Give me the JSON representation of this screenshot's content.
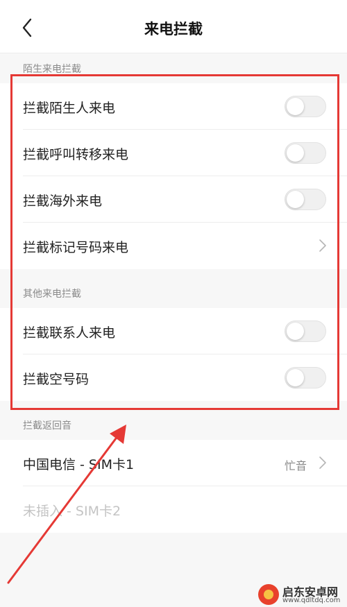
{
  "header": {
    "title": "来电拦截"
  },
  "stranger_section": {
    "label": "陌生来电拦截",
    "rows": [
      {
        "label": "拦截陌生人来电",
        "on": false
      },
      {
        "label": "拦截呼叫转移来电",
        "on": false
      },
      {
        "label": "拦截海外来电",
        "on": false
      },
      {
        "label": "拦截标记号码来电"
      }
    ]
  },
  "other_section": {
    "label": "其他来电拦截",
    "rows": [
      {
        "label": "拦截联系人来电",
        "on": false
      },
      {
        "label": "拦截空号码",
        "on": false
      }
    ]
  },
  "return_tone_section": {
    "label": "拦截返回音",
    "sim1": {
      "label": "中国电信 - SIM卡1",
      "value": "忙音"
    },
    "sim2": {
      "label": "未插入 - SIM卡2"
    }
  },
  "annotation": {
    "color": "#e53935"
  },
  "watermark": {
    "title": "启东安卓网",
    "url": "www.qdltdq.com"
  }
}
